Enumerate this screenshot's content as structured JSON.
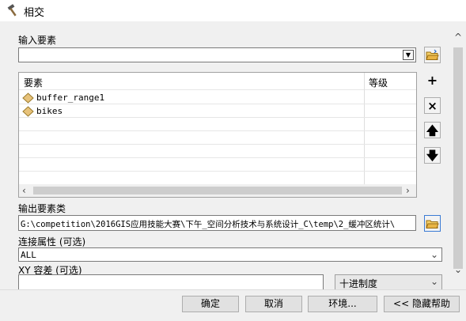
{
  "window": {
    "title": "相交"
  },
  "input_features": {
    "label": "输入要素",
    "value": ""
  },
  "features_table": {
    "col_features": "要素",
    "col_rank": "等级",
    "rows": [
      {
        "name": "buffer_range1"
      },
      {
        "name": "bikes"
      }
    ]
  },
  "side_buttons": {
    "add": "+",
    "remove": "×",
    "up": "🡅",
    "down": "🡇"
  },
  "output": {
    "label": "输出要素类",
    "value": "G:\\competition\\2016GIS应用技能大赛\\下午_空间分析技术与系统设计_C\\temp\\2_缓冲区统计\\"
  },
  "join_attributes": {
    "label": "连接属性 (可选)",
    "value": "ALL"
  },
  "xy_tolerance": {
    "label": "XY 容差 (可选)",
    "value": "",
    "unit": "十进制度"
  },
  "buttons": {
    "ok": "确定",
    "cancel": "取消",
    "environments": "环境...",
    "hide_help": "<< 隐藏帮助"
  },
  "colors": {
    "folder": "#e8b445",
    "feature_icon": "#e7c27a"
  }
}
